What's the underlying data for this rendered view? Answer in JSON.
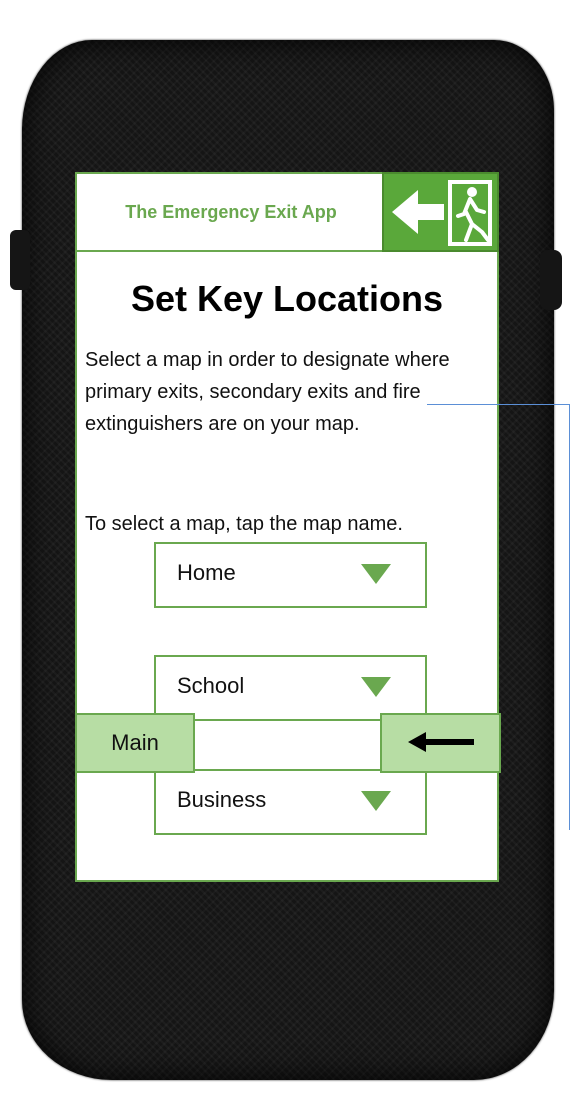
{
  "header": {
    "app_name": "The Emergency Exit App",
    "exit_icon": "emergency-exit-sign-icon"
  },
  "main": {
    "title": "Set Key Locations",
    "description": "Select a map in order to designate where primary exits, secondary exits and fire extinguishers are on your map.",
    "instruction": "To select a map, tap the map name.",
    "maps": [
      {
        "label": "Home",
        "icon": "triangle-down-icon"
      },
      {
        "label": "School",
        "icon": "triangle-down-icon"
      },
      {
        "label": "Business",
        "icon": "triangle-down-icon"
      }
    ]
  },
  "footer": {
    "main_label": "Main",
    "back_icon": "arrow-left-icon"
  },
  "colors": {
    "accent": "#6aa84f",
    "exit_sign": "#5aa83a",
    "button_fill": "#b7dda4",
    "connector": "#5b8fd6",
    "phone_body": "#151515"
  }
}
